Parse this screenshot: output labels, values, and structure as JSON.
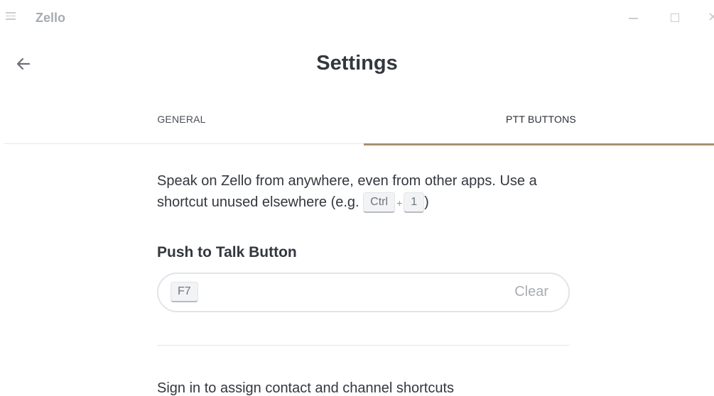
{
  "app": {
    "name": "Zello"
  },
  "page": {
    "title": "Settings"
  },
  "tabs": [
    {
      "label": "GENERAL",
      "active": false
    },
    {
      "label": "PTT BUTTONS",
      "active": true
    }
  ],
  "description": {
    "text": "Speak on Zello from anywhere, even from other apps. Use a shortcut unused elsewhere (e.g.",
    "example_keys": [
      "Ctrl",
      "1"
    ],
    "plus": "+",
    "closing": ")"
  },
  "push_to_talk": {
    "title": "Push to Talk Button",
    "key": "F7",
    "clear_label": "Clear"
  },
  "signin": {
    "text": "Sign in to assign contact and channel shortcuts"
  },
  "colors": {
    "accent": "#a98f72",
    "text": "#33373e",
    "muted": "#a9adb3"
  },
  "icons": {
    "menu": "hamburger-icon",
    "back": "arrow-left-icon",
    "minimize": "minimize-icon",
    "maximize": "maximize-icon",
    "close": "close-icon"
  }
}
